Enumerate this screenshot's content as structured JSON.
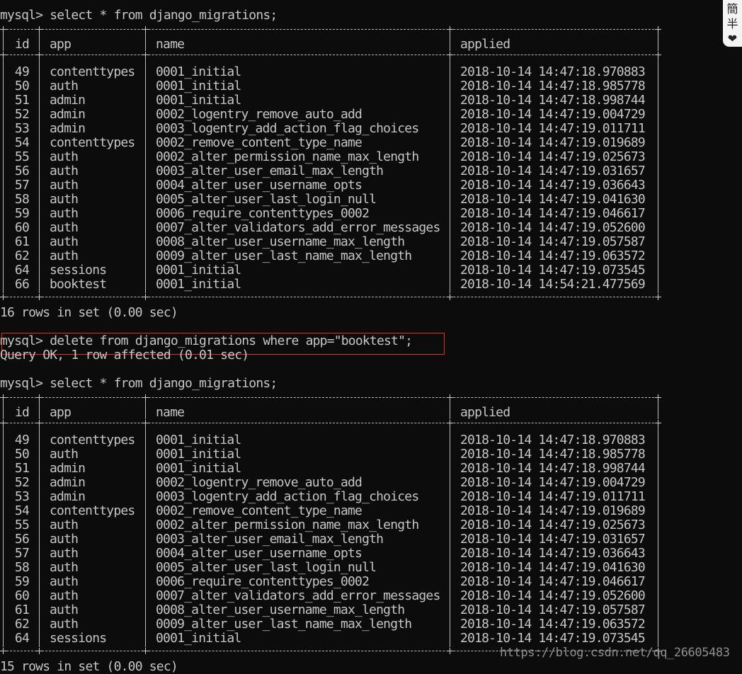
{
  "session": {
    "query1": "mysql> select * from django_migrations;",
    "result1_footer": "16 rows in set (0.00 sec)",
    "delete_command": "mysql> delete from django_migrations where app=\"booktest\";",
    "delete_result": "Query OK, 1 row affected (0.01 sec)",
    "query2": "mysql> select * from django_migrations;",
    "result2_footer": "15 rows in set (0.00 sec)"
  },
  "columns": [
    "id",
    "app",
    "name",
    "applied"
  ],
  "table1": {
    "rows": [
      [
        "49",
        "contenttypes",
        "0001_initial",
        "2018-10-14 14:47:18.970883"
      ],
      [
        "50",
        "auth",
        "0001_initial",
        "2018-10-14 14:47:18.985778"
      ],
      [
        "51",
        "admin",
        "0001_initial",
        "2018-10-14 14:47:18.998744"
      ],
      [
        "52",
        "admin",
        "0002_logentry_remove_auto_add",
        "2018-10-14 14:47:19.004729"
      ],
      [
        "53",
        "admin",
        "0003_logentry_add_action_flag_choices",
        "2018-10-14 14:47:19.011711"
      ],
      [
        "54",
        "contenttypes",
        "0002_remove_content_type_name",
        "2018-10-14 14:47:19.019689"
      ],
      [
        "55",
        "auth",
        "0002_alter_permission_name_max_length",
        "2018-10-14 14:47:19.025673"
      ],
      [
        "56",
        "auth",
        "0003_alter_user_email_max_length",
        "2018-10-14 14:47:19.031657"
      ],
      [
        "57",
        "auth",
        "0004_alter_user_username_opts",
        "2018-10-14 14:47:19.036643"
      ],
      [
        "58",
        "auth",
        "0005_alter_user_last_login_null",
        "2018-10-14 14:47:19.041630"
      ],
      [
        "59",
        "auth",
        "0006_require_contenttypes_0002",
        "2018-10-14 14:47:19.046617"
      ],
      [
        "60",
        "auth",
        "0007_alter_validators_add_error_messages",
        "2018-10-14 14:47:19.052600"
      ],
      [
        "61",
        "auth",
        "0008_alter_user_username_max_length",
        "2018-10-14 14:47:19.057587"
      ],
      [
        "62",
        "auth",
        "0009_alter_user_last_name_max_length",
        "2018-10-14 14:47:19.063572"
      ],
      [
        "64",
        "sessions",
        "0001_initial",
        "2018-10-14 14:47:19.073545"
      ],
      [
        "66",
        "booktest",
        "0001_initial",
        "2018-10-14 14:54:21.477569"
      ]
    ]
  },
  "table2": {
    "rows": [
      [
        "49",
        "contenttypes",
        "0001_initial",
        "2018-10-14 14:47:18.970883"
      ],
      [
        "50",
        "auth",
        "0001_initial",
        "2018-10-14 14:47:18.985778"
      ],
      [
        "51",
        "admin",
        "0001_initial",
        "2018-10-14 14:47:18.998744"
      ],
      [
        "52",
        "admin",
        "0002_logentry_remove_auto_add",
        "2018-10-14 14:47:19.004729"
      ],
      [
        "53",
        "admin",
        "0003_logentry_add_action_flag_choices",
        "2018-10-14 14:47:19.011711"
      ],
      [
        "54",
        "contenttypes",
        "0002_remove_content_type_name",
        "2018-10-14 14:47:19.019689"
      ],
      [
        "55",
        "auth",
        "0002_alter_permission_name_max_length",
        "2018-10-14 14:47:19.025673"
      ],
      [
        "56",
        "auth",
        "0003_alter_user_email_max_length",
        "2018-10-14 14:47:19.031657"
      ],
      [
        "57",
        "auth",
        "0004_alter_user_username_opts",
        "2018-10-14 14:47:19.036643"
      ],
      [
        "58",
        "auth",
        "0005_alter_user_last_login_null",
        "2018-10-14 14:47:19.041630"
      ],
      [
        "59",
        "auth",
        "0006_require_contenttypes_0002",
        "2018-10-14 14:47:19.046617"
      ],
      [
        "60",
        "auth",
        "0007_alter_validators_add_error_messages",
        "2018-10-14 14:47:19.052600"
      ],
      [
        "61",
        "auth",
        "0008_alter_user_username_max_length",
        "2018-10-14 14:47:19.057587"
      ],
      [
        "62",
        "auth",
        "0009_alter_user_last_name_max_length",
        "2018-10-14 14:47:19.063572"
      ],
      [
        "64",
        "sessions",
        "0001_initial",
        "2018-10-14 14:47:19.073545"
      ]
    ]
  },
  "ime_toolbar": {
    "mode_1": "簡",
    "mode_2": "半",
    "icon": "heart-icon"
  },
  "watermark": "https://blog.csdn.net/qq_26605483",
  "colors": {
    "background": "#0c0c0c",
    "text": "#c6c6c6",
    "highlight_box": "#e12b2b"
  }
}
